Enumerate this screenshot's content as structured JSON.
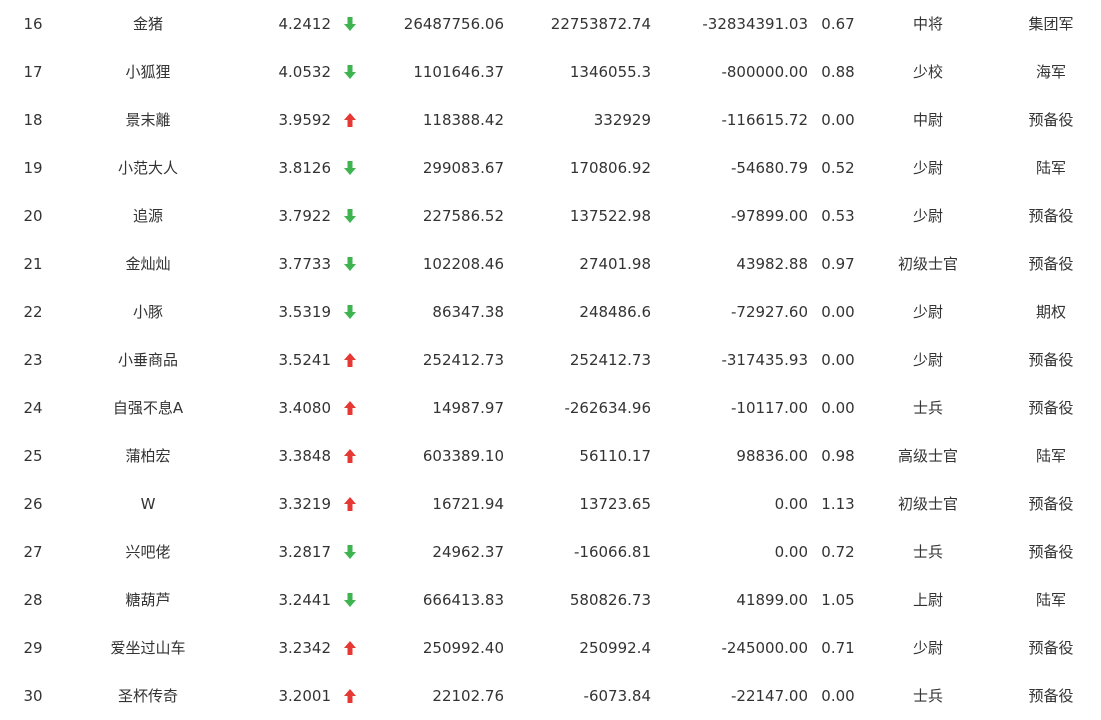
{
  "colors": {
    "up": "#e53935",
    "down": "#3fb34f",
    "text": "#333333"
  },
  "rows": [
    {
      "rank": "16",
      "name": "金猪",
      "score": "4.2412",
      "trend": "down",
      "v1": "26487756.06",
      "v2": "22753872.74",
      "v3": "-32834391.03",
      "ratio": "0.67",
      "rank2": "中将",
      "cat": "集团军"
    },
    {
      "rank": "17",
      "name": "小狐狸",
      "score": "4.0532",
      "trend": "down",
      "v1": "1101646.37",
      "v2": "1346055.3",
      "v3": "-800000.00",
      "ratio": "0.88",
      "rank2": "少校",
      "cat": "海军"
    },
    {
      "rank": "18",
      "name": "景末離",
      "score": "3.9592",
      "trend": "up",
      "v1": "118388.42",
      "v2": "332929",
      "v3": "-116615.72",
      "ratio": "0.00",
      "rank2": "中尉",
      "cat": "预备役"
    },
    {
      "rank": "19",
      "name": "小范大人",
      "score": "3.8126",
      "trend": "down",
      "v1": "299083.67",
      "v2": "170806.92",
      "v3": "-54680.79",
      "ratio": "0.52",
      "rank2": "少尉",
      "cat": "陆军"
    },
    {
      "rank": "20",
      "name": "追源",
      "score": "3.7922",
      "trend": "down",
      "v1": "227586.52",
      "v2": "137522.98",
      "v3": "-97899.00",
      "ratio": "0.53",
      "rank2": "少尉",
      "cat": "预备役"
    },
    {
      "rank": "21",
      "name": "金灿灿",
      "score": "3.7733",
      "trend": "down",
      "v1": "102208.46",
      "v2": "27401.98",
      "v3": "43982.88",
      "ratio": "0.97",
      "rank2": "初级士官",
      "cat": "预备役"
    },
    {
      "rank": "22",
      "name": "小豚",
      "score": "3.5319",
      "trend": "down",
      "v1": "86347.38",
      "v2": "248486.6",
      "v3": "-72927.60",
      "ratio": "0.00",
      "rank2": "少尉",
      "cat": "期权"
    },
    {
      "rank": "23",
      "name": "小垂商品",
      "score": "3.5241",
      "trend": "up",
      "v1": "252412.73",
      "v2": "252412.73",
      "v3": "-317435.93",
      "ratio": "0.00",
      "rank2": "少尉",
      "cat": "预备役"
    },
    {
      "rank": "24",
      "name": "自强不息A",
      "score": "3.4080",
      "trend": "up",
      "v1": "14987.97",
      "v2": "-262634.96",
      "v3": "-10117.00",
      "ratio": "0.00",
      "rank2": "士兵",
      "cat": "预备役"
    },
    {
      "rank": "25",
      "name": "蒲柏宏",
      "score": "3.3848",
      "trend": "up",
      "v1": "603389.10",
      "v2": "56110.17",
      "v3": "98836.00",
      "ratio": "0.98",
      "rank2": "高级士官",
      "cat": "陆军"
    },
    {
      "rank": "26",
      "name": "W",
      "score": "3.3219",
      "trend": "up",
      "v1": "16721.94",
      "v2": "13723.65",
      "v3": "0.00",
      "ratio": "1.13",
      "rank2": "初级士官",
      "cat": "预备役"
    },
    {
      "rank": "27",
      "name": "兴吧佬",
      "score": "3.2817",
      "trend": "down",
      "v1": "24962.37",
      "v2": "-16066.81",
      "v3": "0.00",
      "ratio": "0.72",
      "rank2": "士兵",
      "cat": "预备役"
    },
    {
      "rank": "28",
      "name": "糖葫芦",
      "score": "3.2441",
      "trend": "down",
      "v1": "666413.83",
      "v2": "580826.73",
      "v3": "41899.00",
      "ratio": "1.05",
      "rank2": "上尉",
      "cat": "陆军"
    },
    {
      "rank": "29",
      "name": "爱坐过山车",
      "score": "3.2342",
      "trend": "up",
      "v1": "250992.40",
      "v2": "250992.4",
      "v3": "-245000.00",
      "ratio": "0.71",
      "rank2": "少尉",
      "cat": "预备役"
    },
    {
      "rank": "30",
      "name": "圣杯传奇",
      "score": "3.2001",
      "trend": "up",
      "v1": "22102.76",
      "v2": "-6073.84",
      "v3": "-22147.00",
      "ratio": "0.00",
      "rank2": "士兵",
      "cat": "预备役"
    }
  ]
}
